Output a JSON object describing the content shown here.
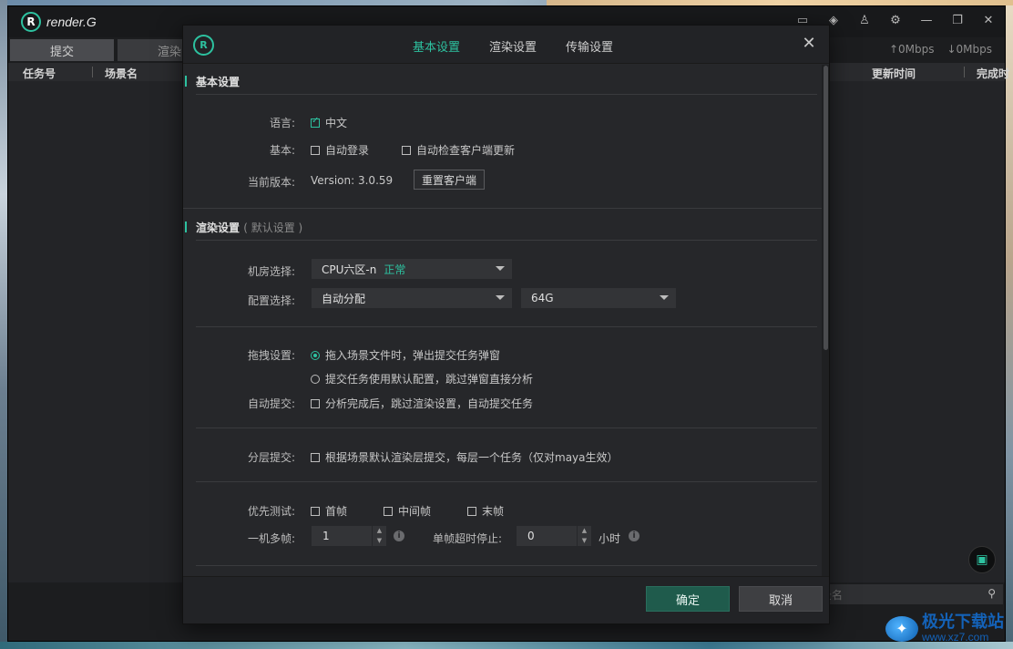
{
  "app": {
    "logo_text": "render.G",
    "tabs": [
      {
        "label": "提交"
      },
      {
        "label": "渲染"
      }
    ],
    "speed_up": "↑0Mbps",
    "speed_down": "↓0Mbps",
    "columns": [
      "任务号",
      "场景名",
      "更新时间",
      "完成时"
    ],
    "search_placeholder": "景名"
  },
  "modal": {
    "logo": "R",
    "tabs": [
      {
        "label": "基本设置",
        "active": true
      },
      {
        "label": "渲染设置",
        "active": false
      },
      {
        "label": "传输设置",
        "active": false
      }
    ],
    "close_glyph": "✕",
    "basic": {
      "title": "基本设置",
      "language_label": "语言:",
      "language_value": "中文",
      "basic_label": "基本:",
      "auto_login": "自动登录",
      "auto_update": "自动检查客户端更新",
      "version_label": "当前版本:",
      "version_value": "Version: 3.0.59",
      "reset_button": "重置客户端"
    },
    "render": {
      "title": "渲染设置",
      "title_sub": "( 默认设置 )",
      "room_label": "机房选择:",
      "room_value": "CPU六区-n",
      "room_status": "正常",
      "config_label": "配置选择:",
      "config_value": "自动分配",
      "memory_value": "64G",
      "drag_label": "拖拽设置:",
      "drag_option1": "拖入场景文件时，弹出提交任务弹窗",
      "drag_option2": "提交任务使用默认配置，跳过弹窗直接分析",
      "auto_submit_label": "自动提交:",
      "auto_submit_text": "分析完成后，跳过渲染设置，自动提交任务",
      "layer_label": "分层提交:",
      "layer_text": "根据场景默认渲染层提交，每层一个任务（仅对maya生效）",
      "priority_label": "优先测试:",
      "priority_first": "首帧",
      "priority_middle": "中间帧",
      "priority_last": "末帧",
      "multi_label": "一机多帧:",
      "multi_value": "1",
      "timeout_label": "单帧超时停止:",
      "timeout_value": "0",
      "timeout_unit": "小时"
    },
    "footer": {
      "confirm": "确定",
      "cancel": "取消"
    }
  },
  "watermark": {
    "title": "极光下载站",
    "url": "www.xz7.com"
  },
  "colors": {
    "accent": "#2dc2a0",
    "modal_bg": "#26272a",
    "app_bg": "#1c1d1f"
  }
}
